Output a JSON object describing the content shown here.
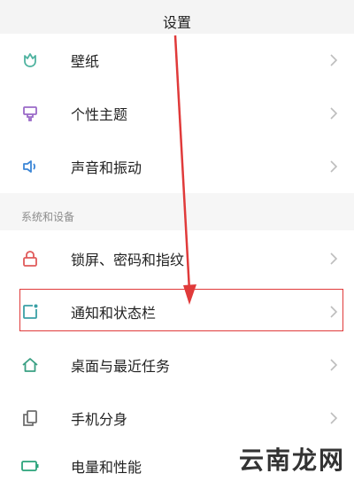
{
  "header": {
    "title": "设置"
  },
  "group1": [
    {
      "label": "壁纸",
      "icon": "tulip-icon",
      "color": "#4fb3a0"
    },
    {
      "label": "个性主题",
      "icon": "theme-brush-icon",
      "color": "#9a6ac8"
    },
    {
      "label": "声音和振动",
      "icon": "speaker-icon",
      "color": "#3b86d6"
    }
  ],
  "section": {
    "label": "系统和设备"
  },
  "group2": [
    {
      "label": "锁屏、密码和指纹",
      "icon": "lock-icon",
      "color": "#e05a5a"
    },
    {
      "label": "通知和状态栏",
      "icon": "notification-icon",
      "color": "#3aa0a6"
    },
    {
      "label": "桌面与最近任务",
      "icon": "home-icon",
      "color": "#3aa083"
    },
    {
      "label": "手机分身",
      "icon": "clone-icon",
      "color": "#6f6f6f"
    },
    {
      "label": "电量和性能",
      "icon": "battery-icon",
      "color": "#2aa37a"
    }
  ],
  "watermark": {
    "text": "云南龙网"
  },
  "colors": {
    "highlight": "#e03a3a",
    "arrow": "#e03a3a"
  }
}
